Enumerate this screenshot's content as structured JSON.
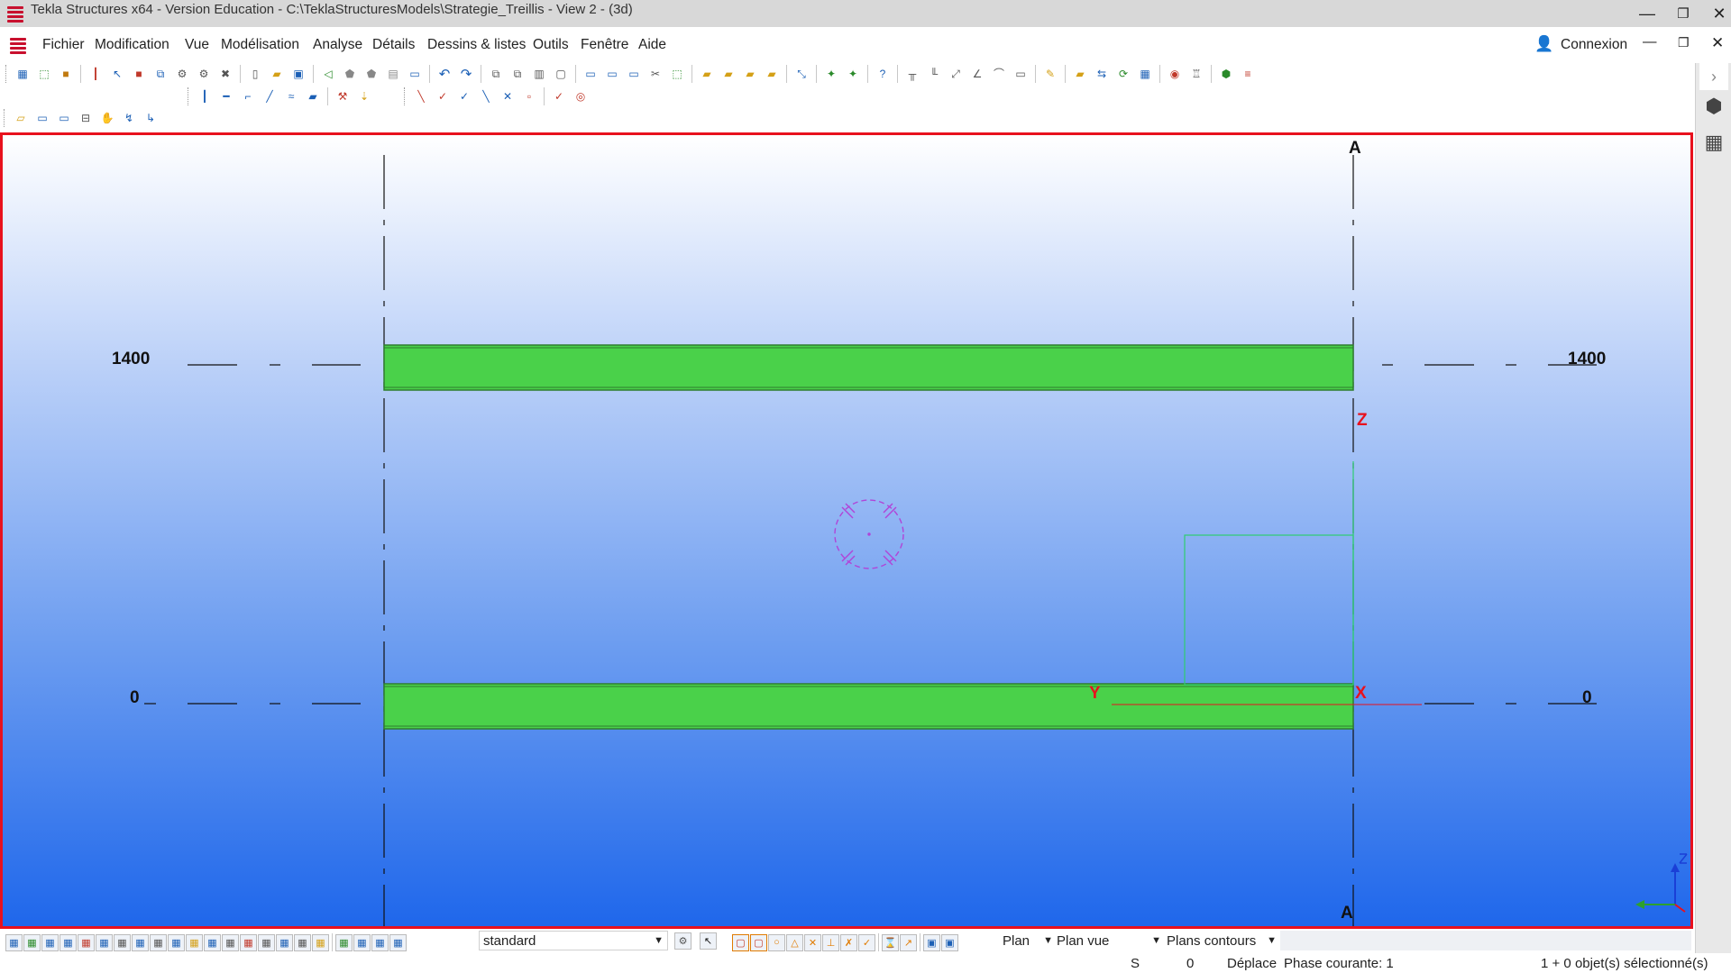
{
  "window": {
    "title": "Tekla Structures x64 - Version Education - C:\\TeklaStructuresModels\\Strategie_Treillis  - View 2 - (3d)",
    "minimize": "—",
    "maximize": "❐",
    "close": "✕"
  },
  "menu": {
    "items": [
      "Fichier",
      "Modification",
      "Vue",
      "Modélisation",
      "Analyse",
      "Détails",
      "Dessins & listes",
      "Outils",
      "Fenêtre",
      "Aide"
    ],
    "connexion": "Connexion",
    "minimize": "—",
    "restore": "❐",
    "close": "✕"
  },
  "side_panel": {
    "collapse_icon": "chevron-right-icon",
    "buttons": [
      "cube-icon",
      "grid-apps-icon"
    ]
  },
  "view": {
    "grid_label_top": "A",
    "grid_label_bottom": "A",
    "level_left_top": "1400",
    "level_right_top": "1400",
    "level_left_bottom": "0",
    "level_right_bottom": "0",
    "axis_y": "Y",
    "axis_x": "X",
    "axis_z": "Z",
    "beam_color": "#4ad14a",
    "border_color": "#e8111d",
    "axis_color": "#e8111d",
    "workplane_color": "#2ecc71",
    "marker_color": "#b044d8"
  },
  "statusbar": {
    "view_setting": "standard",
    "plan_type": "Plan",
    "plan_vue": "Plan vue",
    "plans_contours": "Plans contours"
  },
  "infobar": {
    "mode": "S",
    "count": "0",
    "command": "Déplace",
    "phase": "Phase courante: 1",
    "selection": "1 + 0 objet(s) sélectionné(s)"
  }
}
